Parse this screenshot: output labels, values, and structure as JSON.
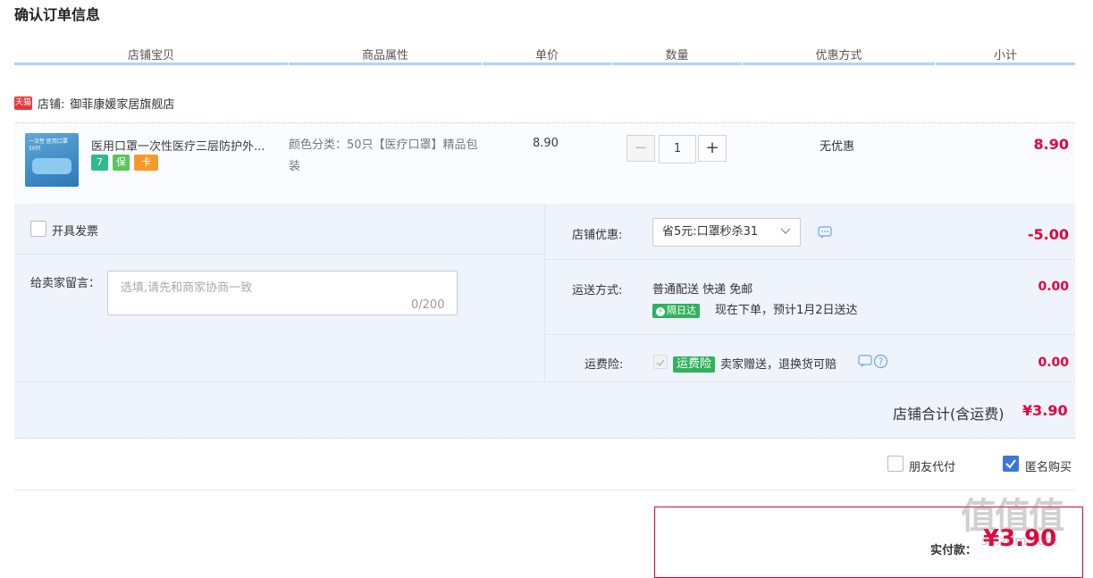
{
  "page_title": "确认订单信息",
  "columns": [
    "店铺宝贝",
    "商品属性",
    "单价",
    "数量",
    "优惠方式",
    "小计"
  ],
  "shop": {
    "tag": "天猫",
    "label": "店铺:",
    "name": "御菲康媛家居旗舰店"
  },
  "item": {
    "thumb_text": "一次性 医用口罩 50只",
    "name": "医用口罩一次性医疗三层防护外...",
    "service_icons": [
      "7",
      "保",
      "卡"
    ],
    "attr": "颜色分类：50只【医疗口罩】精品包装",
    "price": "8.90",
    "qty_minus": "−",
    "qty": "1",
    "qty_plus": "+",
    "promo": "无优惠",
    "subtotal": "8.90"
  },
  "invoice": {
    "label": "开具发票"
  },
  "message": {
    "label": "给卖家留言：",
    "placeholder": "选填,请先和商家协商一致",
    "counter": "0/200"
  },
  "shop_promo": {
    "label": "店铺优惠:",
    "selected": "省5元:口罩秒杀31",
    "amount": "-5.00"
  },
  "shipping": {
    "label": "运送方式:",
    "method": "普通配送 快递 免邮",
    "badge": "隔日达",
    "eta": "现在下单，预计1月2日送达",
    "amount": "0.00"
  },
  "insurance": {
    "label": "运费险:",
    "badge": "运费险",
    "desc": "卖家赠送，退换货可赔",
    "amount": "0.00"
  },
  "shop_total": {
    "label": "店铺合计(含运费)",
    "value": "¥3.90"
  },
  "options": {
    "friend_pay": "朋友代付",
    "anonymous": "匿名购买"
  },
  "pay": {
    "label": "实付款：",
    "value": "¥3.90"
  },
  "watermark": "值 什么值得买"
}
